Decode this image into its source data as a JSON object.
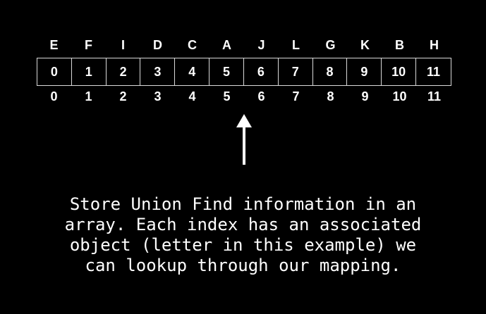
{
  "letters": [
    "E",
    "F",
    "I",
    "D",
    "C",
    "A",
    "J",
    "L",
    "G",
    "K",
    "B",
    "H"
  ],
  "array_values": [
    "0",
    "1",
    "2",
    "3",
    "4",
    "5",
    "6",
    "7",
    "8",
    "9",
    "10",
    "11"
  ],
  "indices": [
    "0",
    "1",
    "2",
    "3",
    "4",
    "5",
    "6",
    "7",
    "8",
    "9",
    "10",
    "11"
  ],
  "caption_lines": [
    "Store Union Find information in an",
    "array. Each index has an associated",
    "object (letter in this example) we",
    "can lookup through our mapping."
  ],
  "colors": {
    "background": "#000000",
    "foreground": "#ffffff",
    "cell_border": "#d9d9d9"
  }
}
